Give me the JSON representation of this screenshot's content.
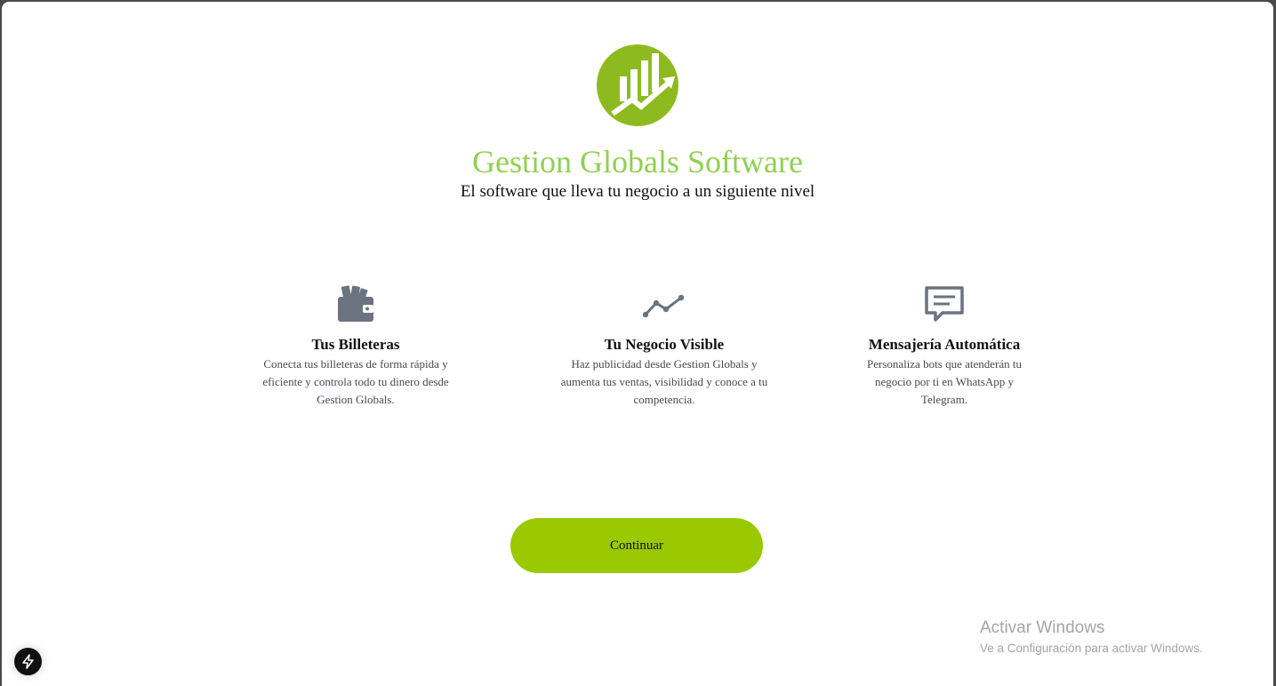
{
  "brand": {
    "name": "Gestion Globals Software",
    "tagline": "El software que lleva tu negocio a un siguiente nivel",
    "accent_color": "#8fd14f",
    "logo_icon": "rising-bar-chart-logo"
  },
  "features": [
    {
      "icon": "wallet-icon",
      "title": "Tus Billeteras",
      "desc_lines": [
        "Conecta tus billeteras de forma rápida y",
        "eficiente y controla todo tu dinero desde",
        "Gestion Globals."
      ]
    },
    {
      "icon": "trend-line-icon",
      "title": "Tu Negocio Visible",
      "desc_lines": [
        "Haz publicidad desde Gestion Globals y",
        "aumenta tus ventas, visibilidad y conoce a tu",
        "competencia."
      ]
    },
    {
      "icon": "message-icon",
      "title": "Mensajería Automática",
      "desc_lines": [
        "Personaliza bots que atenderán tu",
        "negocio por ti en WhatsApp y",
        "Telegram."
      ]
    }
  ],
  "cta": {
    "label": "Continuar",
    "color": "#99c900"
  },
  "windows_watermark": {
    "title": "Activar Windows",
    "subtitle": "Ve a Configuración para activar Windows."
  },
  "dev_badge": {
    "icon": "lightning-bolt-icon"
  }
}
